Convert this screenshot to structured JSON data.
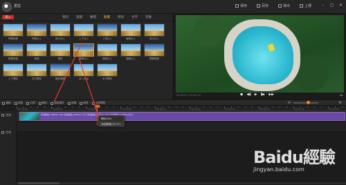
{
  "titlebar": {
    "app_title": "愛剪",
    "actions": [
      {
        "label": "保存",
        "icon": "save-icon"
      },
      {
        "label": "另存",
        "icon": "save-as-icon"
      },
      {
        "label": "導出",
        "icon": "export-icon"
      },
      {
        "label": "上傳",
        "icon": "upload-icon"
      }
    ],
    "window_controls": [
      "–",
      "▢",
      "✕"
    ]
  },
  "library": {
    "add_button": "導入",
    "tabs": [
      "我的",
      "濾鏡",
      "轉場",
      "動畫",
      "特效",
      "文字",
      "音樂"
    ],
    "active_tab_index": 3,
    "items": [
      {
        "label": "閃爍過渡"
      },
      {
        "label": "閃爍淡入"
      },
      {
        "label": "放大淡入"
      },
      {
        "label": "上下淡入"
      },
      {
        "label": "三角淡入"
      },
      {
        "label": "緩慢淡入"
      },
      {
        "label": "放大淡入"
      },
      {
        "label": "模糊過渡"
      },
      {
        "label": "漸隱"
      },
      {
        "label": "擦除"
      },
      {
        "label": "模糊淡入"
      },
      {
        "label": "漸隱淡入"
      },
      {
        "label": "旋轉淡入"
      },
      {
        "label": "模糊過渡"
      },
      {
        "label": "上下擦除"
      },
      {
        "label": "左右擦除"
      },
      {
        "label": "圓形擴展"
      },
      {
        "label": "淡入淡出"
      },
      {
        "label": "水平擦除"
      }
    ],
    "selected_item_index": 10
  },
  "player": {
    "time_left": "00:00:00 / 00:00:10",
    "controls": [
      "◼",
      "◀▮",
      "▶",
      "▮▶",
      "▶▶"
    ],
    "time_right": "◀▶"
  },
  "timeline_toolbar": {
    "tools": [
      {
        "label": "撤銷",
        "icon": "undo-icon"
      },
      {
        "label": "恢復",
        "icon": "redo-icon"
      },
      {
        "label": "分割",
        "icon": "split-icon"
      },
      {
        "label": "刪除",
        "icon": "delete-icon"
      },
      {
        "label": "複製素材",
        "icon": "copy-icon"
      },
      {
        "label": "剪輯",
        "icon": "trim-icon"
      },
      {
        "label": "配音",
        "icon": "mic-icon"
      },
      {
        "label": "全屏預覽",
        "icon": "fullscreen-icon"
      }
    ],
    "zoom_level": 0.6
  },
  "ruler": {
    "labels": [
      "00:00:02",
      "00:00:04",
      "00:00:06",
      "00:00:08",
      "00:00:10",
      "00:00:12",
      "00:00:14",
      "00:00:16",
      "00:00:18",
      "00:00:20"
    ]
  },
  "tracks": {
    "video_label": "視頻",
    "audio_label": "音頻",
    "clip_label": "泳池航拍 (1080p).mp4 泳池航拍 (1080p).mp4 泳池航拍 (1080p).mp4 泳池航拍 (1080p).mp4"
  },
  "context_menu": {
    "items": [
      "刪除(Del)",
      "添加轉場(Ctrl+T)"
    ]
  },
  "watermark": {
    "word": "Baidu經驗",
    "sub": "jingyan.baidu.com"
  },
  "colors": {
    "accent": "#e39a2d",
    "add_button": "#c8302b",
    "clip": "#6a4aa3",
    "playhead": "#e0602b",
    "annotation": "#e23b2e"
  }
}
